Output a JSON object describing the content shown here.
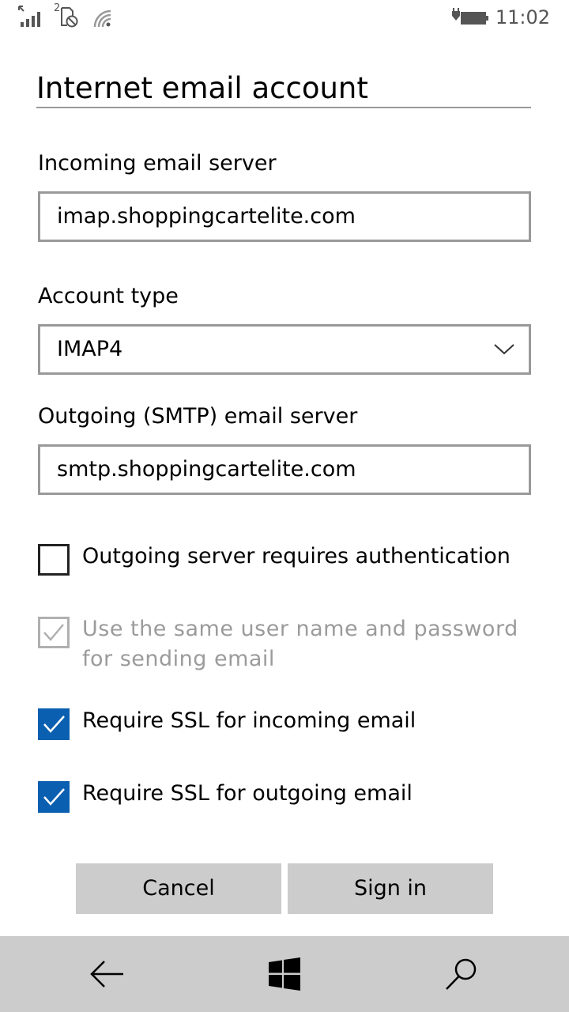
{
  "status_bar": {
    "time": "11:02",
    "sim_slot": "2",
    "icons": [
      "signal-icon",
      "sim-blocked-icon",
      "wifi-icon",
      "battery-charging-icon"
    ]
  },
  "title": "Internet email account",
  "incoming": {
    "label": "Incoming email server",
    "value": "imap.shoppingcartelite.com"
  },
  "account_type": {
    "label": "Account type",
    "selected": "IMAP4"
  },
  "outgoing": {
    "label": "Outgoing (SMTP) email server",
    "value": "smtp.shoppingcartelite.com"
  },
  "checkboxes": [
    {
      "label": "Outgoing server requires authentication",
      "checked": false,
      "enabled": true
    },
    {
      "label": "Use the same user name and password for sending email",
      "checked": true,
      "enabled": false
    },
    {
      "label": "Require SSL for incoming email",
      "checked": true,
      "enabled": true
    },
    {
      "label": "Require SSL for outgoing email",
      "checked": true,
      "enabled": true
    }
  ],
  "buttons": {
    "cancel": "Cancel",
    "sign_in": "Sign in"
  },
  "nav": [
    "back-arrow-icon",
    "windows-start-icon",
    "search-icon"
  ],
  "colors": {
    "accent": "#0a5fb0",
    "nav_bar": "#cccccc",
    "button_bg": "#cccccc",
    "disabled_text": "#9b9b9b"
  }
}
